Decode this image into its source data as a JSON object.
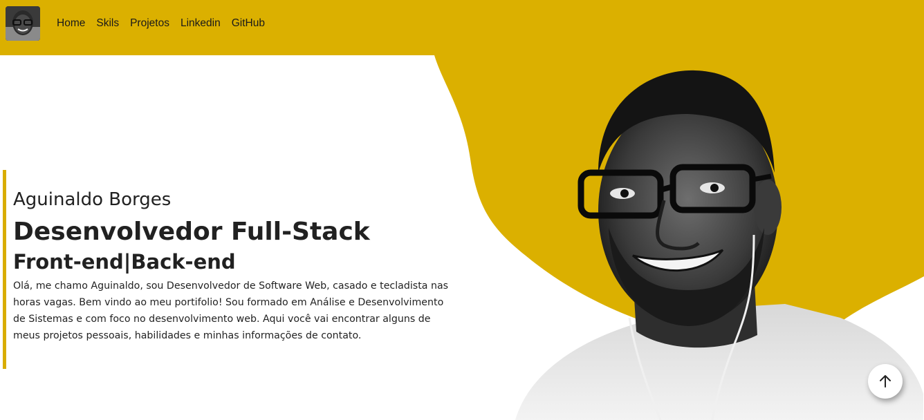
{
  "colors": {
    "accent": "#dbb000",
    "background": "#ffffff",
    "text": "#212121"
  },
  "nav": {
    "avatar_icon": "profile-photo",
    "links": [
      {
        "label": "Home"
      },
      {
        "label": "Skils"
      },
      {
        "label": "Projetos"
      },
      {
        "label": "Linkedin"
      },
      {
        "label": "GitHub"
      }
    ]
  },
  "hero": {
    "name": "Aguinaldo Borges",
    "role": "Desenvolvedor Full-Stack",
    "subtitle": "Front-end|Back-end",
    "description": "Olá, me chamo Aguinaldo, sou Desenvolvedor de Software Web, casado e tecladista nas horas vagas. Bem vindo ao meu portifolio! Sou formado em Análise e Desenvolvimento de Sistemas e com foco no desenvolvimento web. Aqui você vai encontrar alguns de meus projetos pessoais, habilidades e minhas informações de contato."
  },
  "back_to_top": {
    "icon": "arrow-up-icon"
  }
}
